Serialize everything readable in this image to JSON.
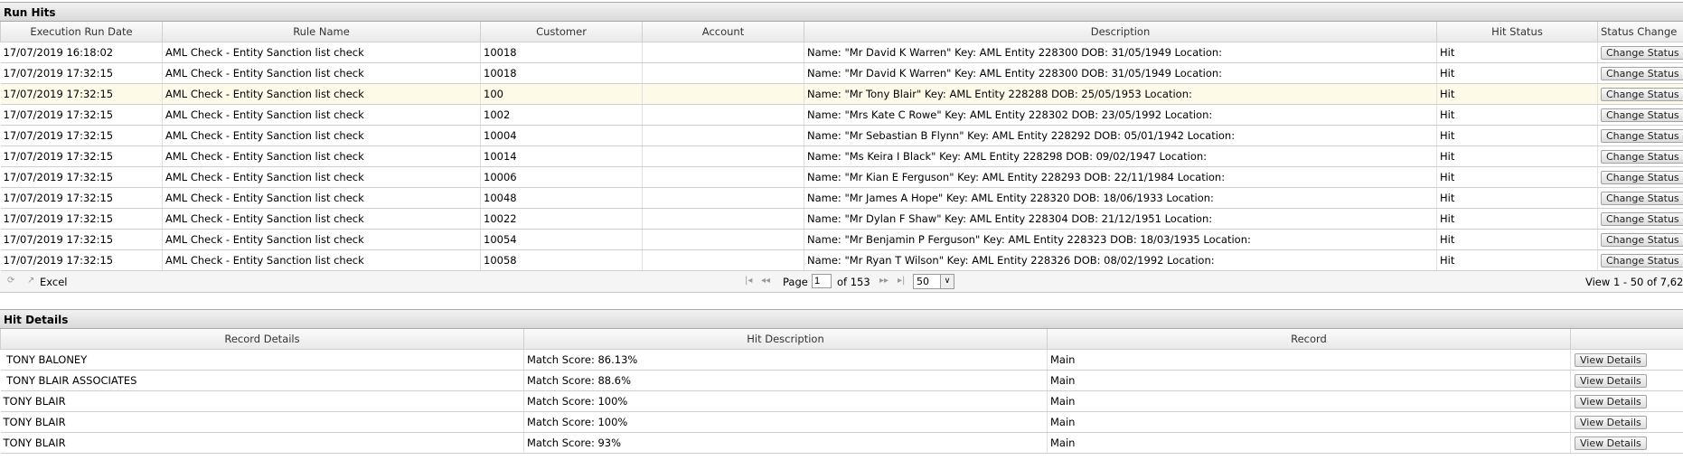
{
  "run_hits": {
    "title": "Run Hits",
    "columns": [
      "Execution Run Date",
      "Rule Name",
      "Customer",
      "Account",
      "Description",
      "Hit Status",
      "Status Change"
    ],
    "rows": [
      {
        "date": "17/07/2019 16:18:02",
        "rule": "AML Check - Entity Sanction list check",
        "customer": "10018",
        "account": "",
        "description": "Name: \"Mr David K Warren\" Key: AML Entity 228300 DOB: 31/05/1949 Location:",
        "status": "Hit",
        "action": "Change Status"
      },
      {
        "date": "17/07/2019 17:32:15",
        "rule": "AML Check - Entity Sanction list check",
        "customer": "10018",
        "account": "",
        "description": "Name: \"Mr David K Warren\" Key: AML Entity 228300 DOB: 31/05/1949 Location:",
        "status": "Hit",
        "action": "Change Status"
      },
      {
        "date": "17/07/2019 17:32:15",
        "rule": "AML Check - Entity Sanction list check",
        "customer": "100",
        "account": "",
        "description": "Name: \"Mr Tony Blair\" Key: AML Entity 228288 DOB: 25/05/1953 Location:",
        "status": "Hit",
        "action": "Change Status"
      },
      {
        "date": "17/07/2019 17:32:15",
        "rule": "AML Check - Entity Sanction list check",
        "customer": "1002",
        "account": "",
        "description": "Name: \"Mrs Kate C Rowe\" Key: AML Entity 228302 DOB: 23/05/1992 Location:",
        "status": "Hit",
        "action": "Change Status"
      },
      {
        "date": "17/07/2019 17:32:15",
        "rule": "AML Check - Entity Sanction list check",
        "customer": "10004",
        "account": "",
        "description": "Name: \"Mr Sebastian B Flynn\" Key: AML Entity 228292 DOB: 05/01/1942 Location:",
        "status": "Hit",
        "action": "Change Status"
      },
      {
        "date": "17/07/2019 17:32:15",
        "rule": "AML Check - Entity Sanction list check",
        "customer": "10014",
        "account": "",
        "description": "Name: \"Ms Keira I Black\" Key: AML Entity 228298 DOB: 09/02/1947 Location:",
        "status": "Hit",
        "action": "Change Status"
      },
      {
        "date": "17/07/2019 17:32:15",
        "rule": "AML Check - Entity Sanction list check",
        "customer": "10006",
        "account": "",
        "description": "Name: \"Mr Kian E Ferguson\" Key: AML Entity 228293 DOB: 22/11/1984 Location:",
        "status": "Hit",
        "action": "Change Status"
      },
      {
        "date": "17/07/2019 17:32:15",
        "rule": "AML Check - Entity Sanction list check",
        "customer": "10048",
        "account": "",
        "description": "Name: \"Mr James A Hope\" Key: AML Entity 228320 DOB: 18/06/1933 Location:",
        "status": "Hit",
        "action": "Change Status"
      },
      {
        "date": "17/07/2019 17:32:15",
        "rule": "AML Check - Entity Sanction list check",
        "customer": "10022",
        "account": "",
        "description": "Name: \"Mr Dylan F Shaw\" Key: AML Entity 228304 DOB: 21/12/1951 Location:",
        "status": "Hit",
        "action": "Change Status"
      },
      {
        "date": "17/07/2019 17:32:15",
        "rule": "AML Check - Entity Sanction list check",
        "customer": "10054",
        "account": "",
        "description": "Name: \"Mr Benjamin P Ferguson\" Key: AML Entity 228323 DOB: 18/03/1935 Location:",
        "status": "Hit",
        "action": "Change Status"
      },
      {
        "date": "17/07/2019 17:32:15",
        "rule": "AML Check - Entity Sanction list check",
        "customer": "10058",
        "account": "",
        "description": "Name: \"Mr Ryan T Wilson\" Key: AML Entity 228326 DOB: 08/02/1992 Location:",
        "status": "Hit",
        "action": "Change Status"
      }
    ],
    "pager": {
      "refresh_icon": "refresh-icon",
      "export_icon": "export-icon",
      "excel_label": "Excel",
      "page_label": "Page",
      "page_value": "1",
      "of_label": "of 153",
      "page_size": "50",
      "view_text": "View 1 - 50 of 7,62"
    }
  },
  "hit_details": {
    "title": "Hit Details",
    "columns": [
      "Record Details",
      "Hit Description",
      "Record",
      ""
    ],
    "rows": [
      {
        "record_details": " TONY BALONEY",
        "hit_description": "Match Score: 86.13%",
        "record": "Main",
        "action": "View Details"
      },
      {
        "record_details": " TONY BLAIR ASSOCIATES",
        "hit_description": "Match Score: 88.6%",
        "record": "Main",
        "action": "View Details"
      },
      {
        "record_details": "TONY BLAIR",
        "hit_description": "Match Score: 100%",
        "record": "Main",
        "action": "View Details"
      },
      {
        "record_details": "TONY BLAIR",
        "hit_description": "Match Score: 100%",
        "record": "Main",
        "action": "View Details"
      },
      {
        "record_details": "TONY BLAIR",
        "hit_description": "Match Score: 93%",
        "record": "Main",
        "action": "View Details"
      }
    ]
  }
}
